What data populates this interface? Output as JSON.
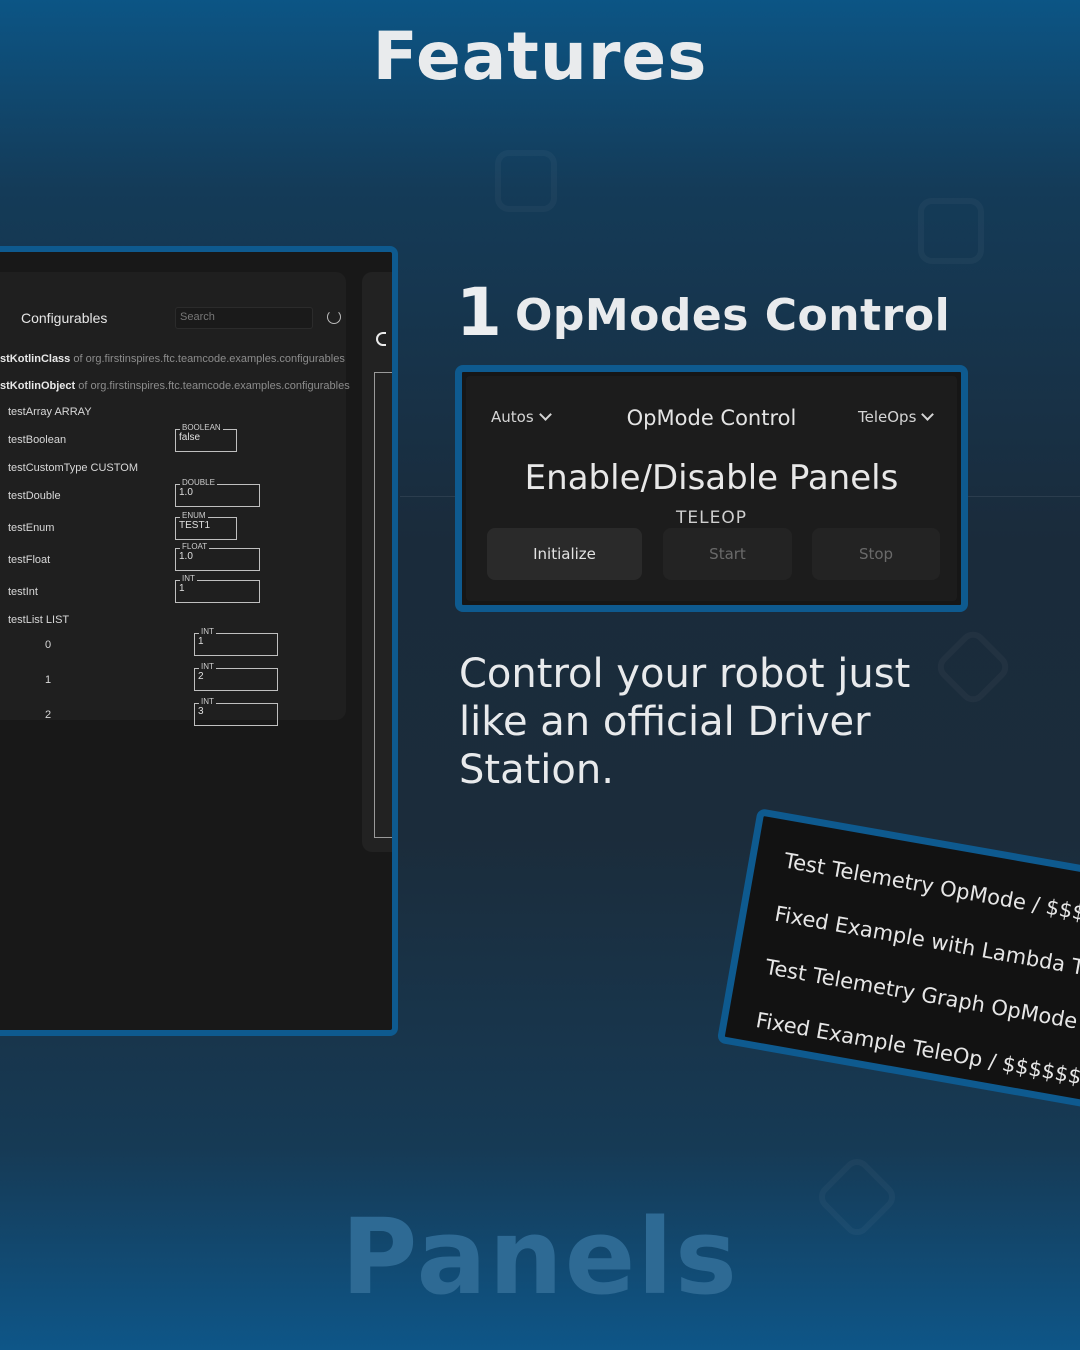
{
  "headings": {
    "top": "Features",
    "bottom": "Panels"
  },
  "configurables": {
    "title": "Configurables",
    "search_placeholder": "Search",
    "class_rows": [
      {
        "name": "stKotlinClass",
        "package": "of org.firstinspires.ftc.teamcode.examples.configurables"
      },
      {
        "name": "stKotlinObject",
        "package": "of org.firstinspires.ftc.teamcode.examples.configurables"
      }
    ],
    "rows": {
      "array": "testArray ARRAY",
      "boolean": "testBoolean",
      "custom": "testCustomType CUSTOM",
      "double": "testDouble",
      "enum": "testEnum",
      "float": "testFloat",
      "int": "testInt",
      "list": "testList LIST"
    },
    "fields": {
      "boolean": {
        "type": "BOOLEAN",
        "value": "false"
      },
      "double": {
        "type": "DOUBLE",
        "value": "1.0"
      },
      "enum": {
        "type": "ENUM",
        "value": "TEST1"
      },
      "float": {
        "type": "FLOAT",
        "value": "1.0"
      },
      "int": {
        "type": "INT",
        "value": "1"
      }
    },
    "list_items": [
      {
        "index": "0",
        "type": "INT",
        "value": "1"
      },
      {
        "index": "1",
        "type": "INT",
        "value": "2"
      },
      {
        "index": "2",
        "type": "INT",
        "value": "3"
      }
    ]
  },
  "section": {
    "number": "1",
    "title": "OpModes Control"
  },
  "opmode_control": {
    "autos_label": "Autos",
    "title": "OpMode Control",
    "teleops_label": "TeleOps",
    "selected_opmode": "Enable/Disable Panels",
    "mode": "TELEOP",
    "buttons": {
      "initialize": "Initialize",
      "start": "Start",
      "stop": "Stop"
    }
  },
  "description": "Control your robot just like an official Driver Station.",
  "opmode_list": [
    "Test Telemetry OpMode / $$$$",
    "Fixed Example with Lambda TeleOp",
    "Test Telemetry Graph OpMode / $$$",
    "Fixed Example TeleOp / $$$$$$"
  ]
}
